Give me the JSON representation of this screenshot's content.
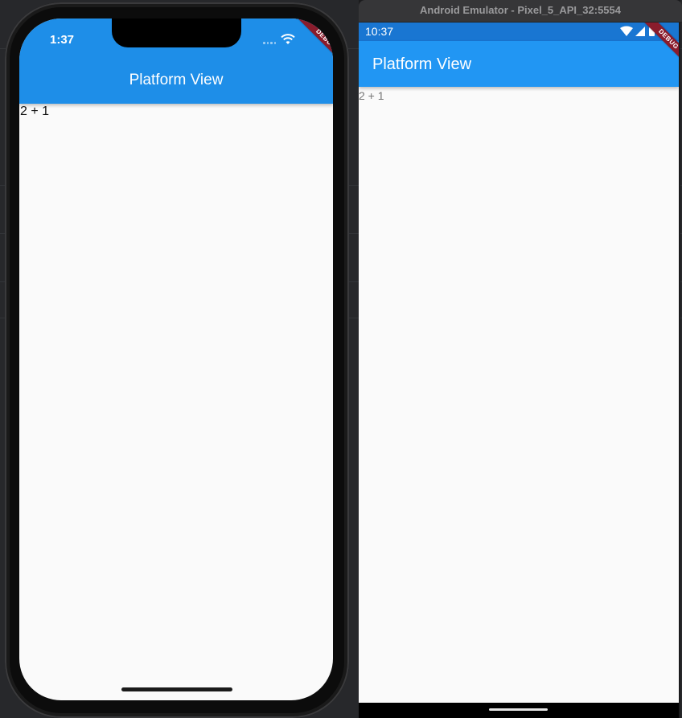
{
  "ios": {
    "status_time": "1:37",
    "app_title": "Platform View",
    "body_text": "2 + 1",
    "debug_label": "DEBUG"
  },
  "android": {
    "window_title": "Android Emulator - Pixel_5_API_32:5554",
    "status_time": "10:37",
    "app_title": "Platform View",
    "body_text": "2 + 1",
    "debug_label": "DEBUG"
  },
  "colors": {
    "ios_appbar": "#1e8ee8",
    "android_appbar": "#2196f3",
    "android_statusbar": "#1976d2",
    "debug_banner": "#8a1c2c",
    "screen_background": "#fafafa"
  },
  "icons": [
    "wifi-icon",
    "cellular-signal-icon",
    "battery-icon"
  ]
}
